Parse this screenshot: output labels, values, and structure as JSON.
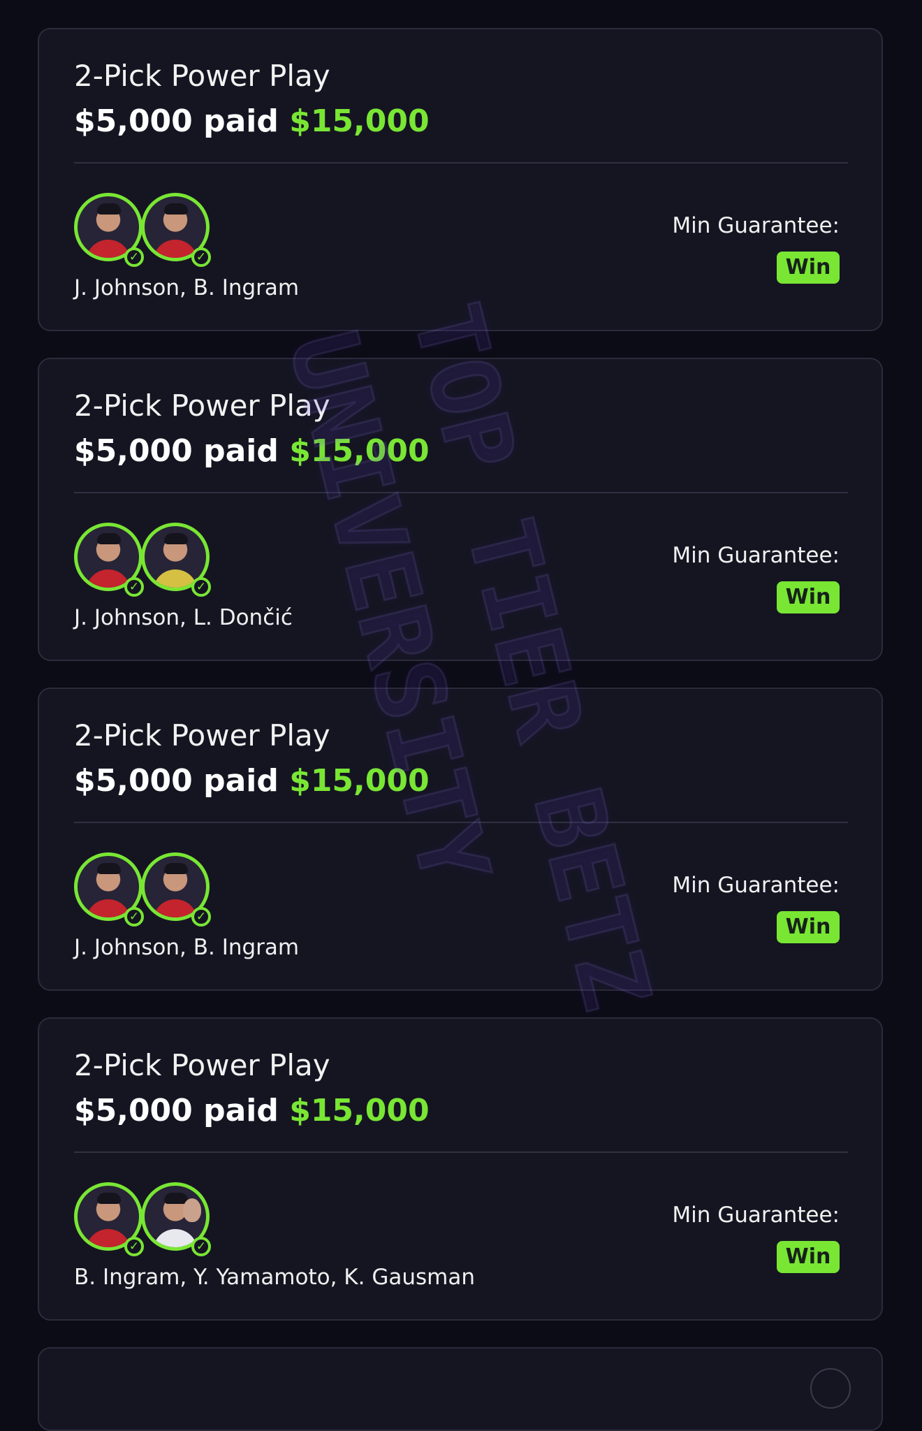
{
  "cards": [
    {
      "title": "2-Pick Power Play",
      "paid": "$5,000 paid",
      "payout": "$15,000",
      "players": "J. Johnson, B. Ingram",
      "min_label": "Min Guarantee:",
      "result": "Win"
    },
    {
      "title": "2-Pick Power Play",
      "paid": "$5,000 paid",
      "payout": "$15,000",
      "players": "J. Johnson, L. Dončić",
      "min_label": "Min Guarantee:",
      "result": "Win"
    },
    {
      "title": "2-Pick Power Play",
      "paid": "$5,000 paid",
      "payout": "$15,000",
      "players": "J. Johnson, B. Ingram",
      "min_label": "Min Guarantee:",
      "result": "Win"
    },
    {
      "title": "2-Pick Power Play",
      "paid": "$5,000 paid",
      "payout": "$15,000",
      "players": "B. Ingram, Y. Yamamoto, K. Gausman",
      "min_label": "Min Guarantee:",
      "result": "Win"
    }
  ],
  "watermark": {
    "line1": "TOP TIER BETZ",
    "line2": "UNIVERSITY"
  },
  "colors": {
    "background": "#0c0c16",
    "card": "#151522",
    "accent": "#79e634",
    "watermark": "#6c4fd0"
  },
  "icons": {
    "avatar": "player-avatar",
    "check": "checkmark-icon"
  }
}
